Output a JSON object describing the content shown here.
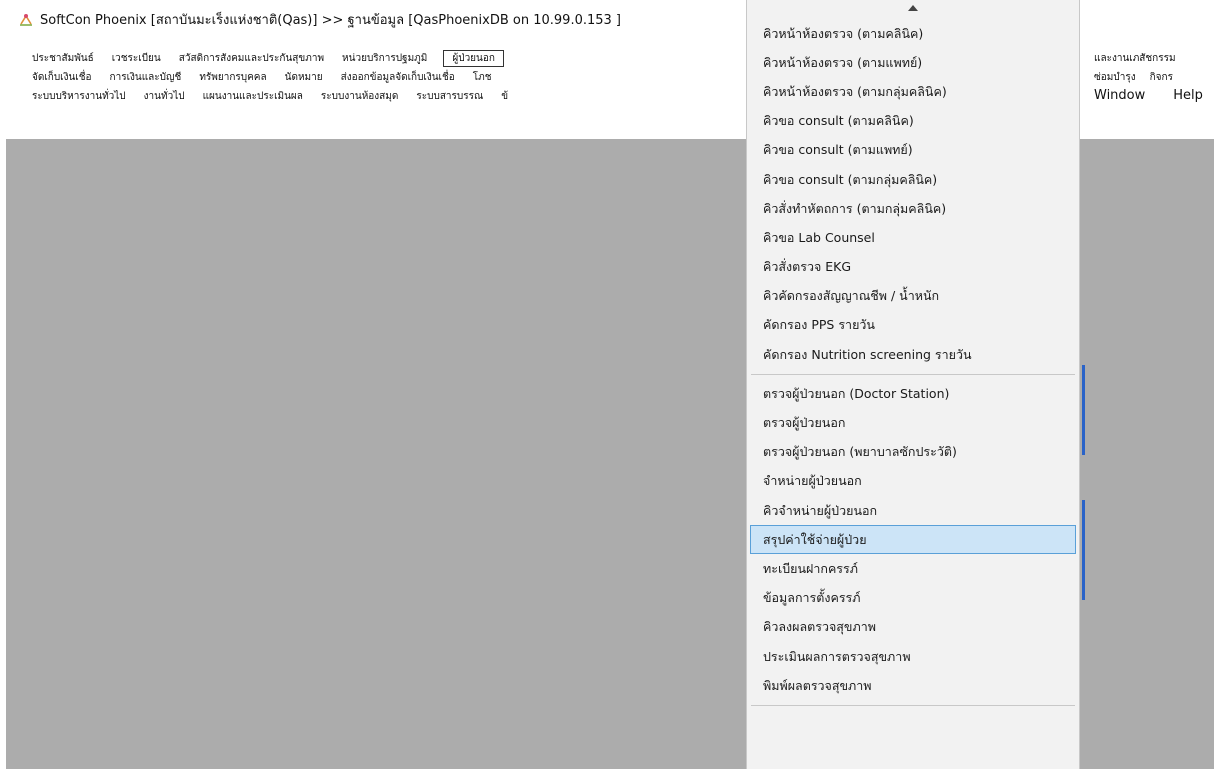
{
  "window": {
    "title": "SoftCon Phoenix [สถาบันมะเร็งแห่งชาติ(Qas)]  >>  ฐานข้อมูล [QasPhoenixDB on 10.99.0.153 ]"
  },
  "menubar": {
    "row1": [
      "ประชาสัมพันธ์",
      "เวชระเบียน",
      "สวัสดิการสังคมและประกันสุขภาพ",
      "หน่วยบริการปฐมภูมิ",
      "ผู้ป่วยนอก"
    ],
    "row2": [
      "จัดเก็บเงินเชื่อ",
      "การเงินและบัญชี",
      "ทรัพยากรบุคคล",
      "นัดหมาย",
      "ส่งออกข้อมูลจัดเก็บเงินเชื่อ",
      "โภช"
    ],
    "row3": [
      "ระบบบริหารงานทั่วไป",
      "งานทั่วไป",
      "แผนงานและประเมินผล",
      "ระบบงานห้องสมุด",
      "ระบบสารบรรณ",
      "ข้"
    ],
    "right_row1": [
      "และงานเภสัชกรรม"
    ],
    "right_row2": [
      "ซ่อมบำรุง",
      "กิจกร"
    ],
    "right_row3": [
      "Window",
      "Help"
    ]
  },
  "dropdown": {
    "group1": [
      "คิวหน้าห้องตรวจ (ตามคลินิค)",
      "คิวหน้าห้องตรวจ (ตามแพทย์)",
      "คิวหน้าห้องตรวจ (ตามกลุ่มคลินิค)",
      "คิวขอ consult (ตามคลินิค)",
      "คิวขอ consult (ตามแพทย์)",
      "คิวขอ consult (ตามกลุ่มคลินิค)",
      "คิวสั่งทำหัตถการ (ตามกลุ่มคลินิค)",
      "คิวขอ Lab Counsel",
      "คิวสั่งตรวจ EKG",
      "คิวคัดกรองสัญญาณชีพ / น้ำหนัก",
      "คัดกรอง PPS รายวัน",
      "คัดกรอง Nutrition screening รายวัน"
    ],
    "group2": [
      "ตรวจผู้ป่วยนอก (Doctor Station)",
      "ตรวจผู้ป่วยนอก",
      "ตรวจผู้ป่วยนอก (พยาบาลซักประวัติ)",
      "จำหน่ายผู้ป่วยนอก",
      "คิวจำหน่ายผู้ป่วยนอก",
      "สรุปค่าใช้จ่ายผู้ป่วย",
      "ทะเบียนฝากครรภ์",
      "ข้อมูลการตั้งครรภ์",
      "คิวลงผลตรวจสุขภาพ",
      "ประเมินผลการตรวจสุขภาพ",
      "พิมพ์ผลตรวจสุขภาพ"
    ],
    "selected_index_group2": 5
  },
  "colors": {
    "workspace": "#acacac",
    "selection_bg": "#cce4f7",
    "selection_border": "#5aa0d8",
    "accent_edge": "#2a63c8"
  }
}
